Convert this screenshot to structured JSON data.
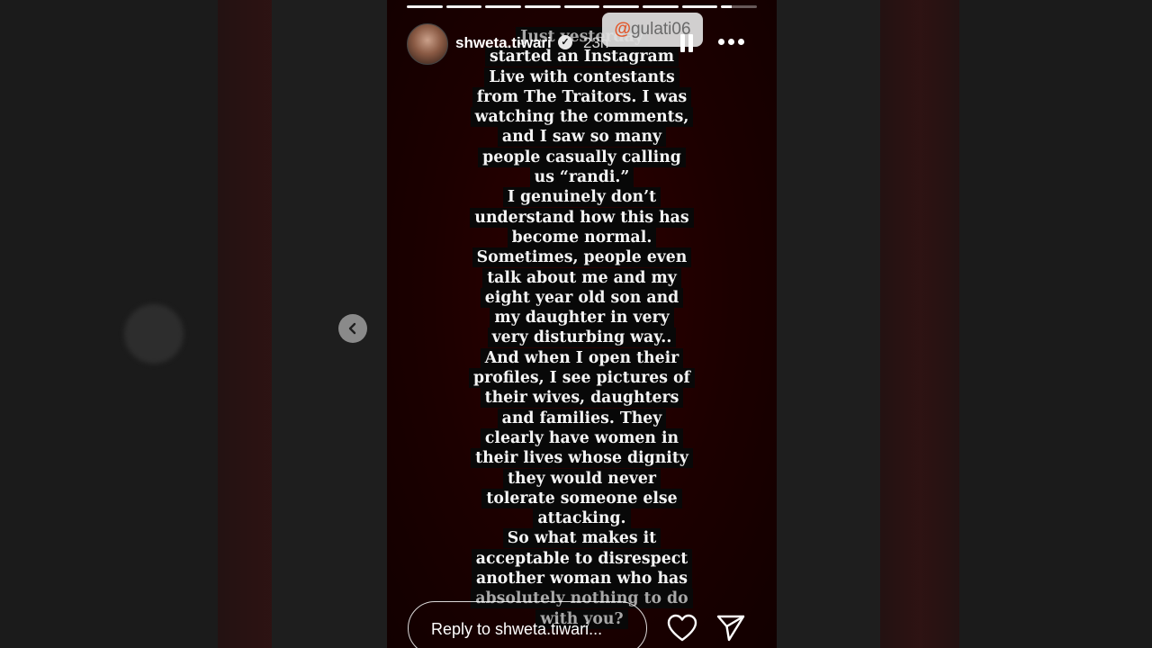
{
  "story": {
    "username": "shweta.tiwari",
    "verified_glyph": "✓",
    "time_ago": "23h",
    "mention_at": "@",
    "mention_sticker": "gulati06",
    "text_lines": [
      "Just yesterday",
      "started an Instagram",
      "Live with contestants",
      "from The Traitors. I was",
      "watching the comments,",
      "and I saw so many",
      "people casually calling",
      "us “randi.”",
      "I genuinely don’t",
      "understand how this has",
      "become normal.",
      "Sometimes, people even",
      "talk about me and my",
      "eight year old son and",
      "my daughter in very",
      "very disturbing way..",
      "And when I open their",
      "profiles, I see pictures of",
      "their wives, daughters",
      "and families. They",
      "clearly have women in",
      "their lives whose dignity",
      "they would never",
      "tolerate someone else",
      "attacking.",
      "So what makes it",
      "acceptable to disrespect",
      "another woman who has",
      "absolutely nothing to do",
      "with you?"
    ],
    "progress_segments": 9
  },
  "reply": {
    "placeholder": "Reply to shweta.tiwari..."
  },
  "icons": {
    "pause": "pause-icon",
    "more": "more-icon",
    "heart": "heart-icon",
    "send": "send-icon",
    "prev": "chevron-left-icon",
    "verified": "verified-badge-icon"
  }
}
